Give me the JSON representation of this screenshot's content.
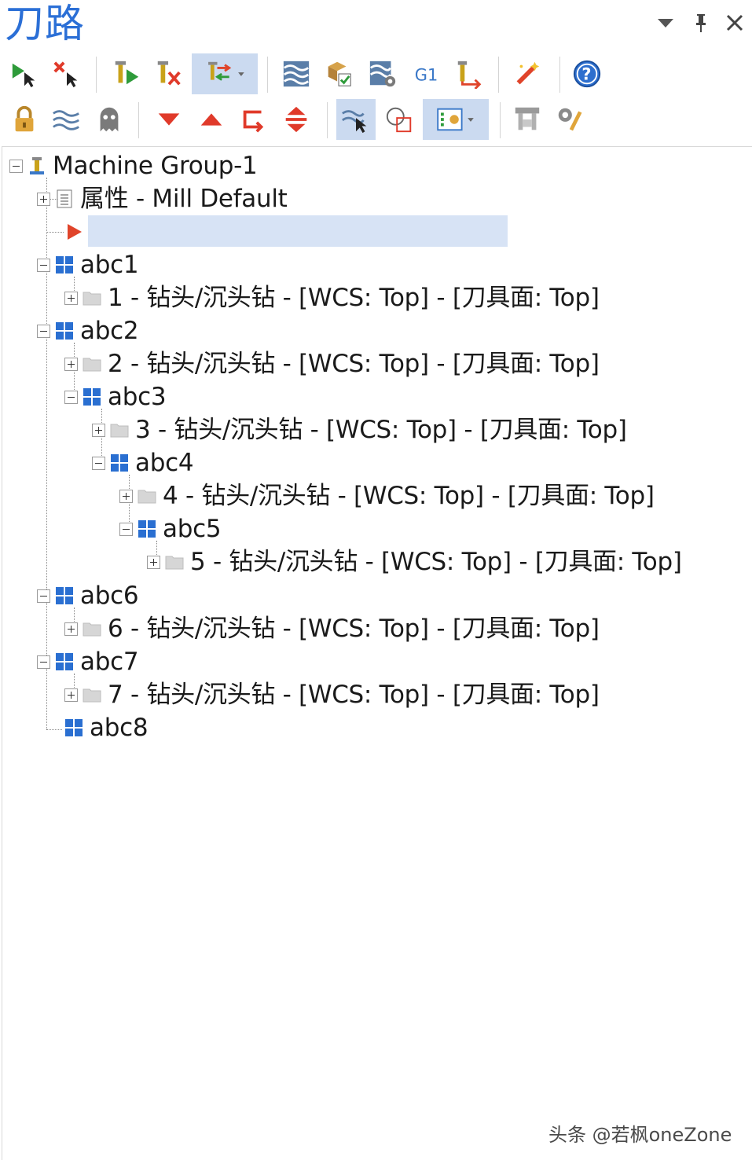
{
  "panel": {
    "title": "刀路"
  },
  "window_controls": [
    "dropdown-arrow-icon",
    "pin-icon",
    "close-icon"
  ],
  "toolbar": {
    "row1": [
      "select-all-ops-icon",
      "deselect-ops-icon",
      "regen-selected-icon",
      "regen-dirty-icon",
      "toggle-sort-icon",
      "backplot-icon",
      "verify-icon",
      "simulate-icon",
      "post-g1-icon",
      "toggle-toolpath-icon",
      "wizard-icon",
      "help-icon"
    ],
    "row2": [
      "lock-icon",
      "toggle-display-icon",
      "ghost-icon",
      "move-down-icon",
      "move-up-icon",
      "insert-arrow-icon",
      "scroll-icon",
      "display-selected-icon",
      "graphics-icon",
      "list-options-icon",
      "machine-sim-icon",
      "tool-settings-icon"
    ]
  },
  "tree": {
    "machine_group": "Machine Group-1",
    "properties": "属性 - Mill Default",
    "groups": [
      {
        "id": "abc1",
        "label": "abc1",
        "op": "1 - 钻头/沉头钻 - [WCS: Top] - [刀具面: Top]"
      },
      {
        "id": "abc2",
        "label": "abc2",
        "op": "2 - 钻头/沉头钻 - [WCS: Top] - [刀具面: Top]"
      },
      {
        "id": "abc3",
        "label": "abc3",
        "op": "3 - 钻头/沉头钻 - [WCS: Top] - [刀具面: Top]"
      },
      {
        "id": "abc4",
        "label": "abc4",
        "op": "4 - 钻头/沉头钻 - [WCS: Top] - [刀具面: Top]"
      },
      {
        "id": "abc5",
        "label": "abc5",
        "op": "5 - 钻头/沉头钻 - [WCS: Top] - [刀具面: Top]"
      },
      {
        "id": "abc6",
        "label": "abc6",
        "op": "6 - 钻头/沉头钻 - [WCS: Top] - [刀具面: Top]"
      },
      {
        "id": "abc7",
        "label": "abc7",
        "op": "7 - 钻头/沉头钻 - [WCS: Top] - [刀具面: Top]"
      },
      {
        "id": "abc8",
        "label": "abc8"
      }
    ]
  },
  "watermark": "头条 @若枫oneZone",
  "colors": {
    "title": "#2b6fd6",
    "highlight": "#d7e3f5",
    "group_icon": "#2a6fd1",
    "insert_arrow": "#e0442a"
  }
}
